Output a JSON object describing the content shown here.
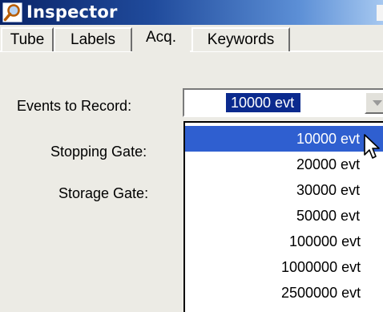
{
  "window": {
    "title": "Inspector",
    "icon": "magnifier-icon"
  },
  "tabs": [
    {
      "label": "Tube",
      "active": false
    },
    {
      "label": "Labels",
      "active": false
    },
    {
      "label": "Acq.",
      "active": true
    },
    {
      "label": "Keywords",
      "active": false
    }
  ],
  "form": {
    "events_label": "Events to Record:",
    "stopping_label": "Stopping Gate:",
    "storage_label": "Storage Gate:",
    "events_value": "10000 evt"
  },
  "dropdown": {
    "options": [
      "10000 evt",
      "20000 evt",
      "30000 evt",
      "50000 evt",
      "100000 evt",
      "1000000 evt",
      "2500000 evt"
    ],
    "selected_index": 0
  },
  "colors": {
    "selection": "#2f5fd0",
    "titlebar": "#0a2468",
    "dialog_background": "#ecebe5"
  }
}
